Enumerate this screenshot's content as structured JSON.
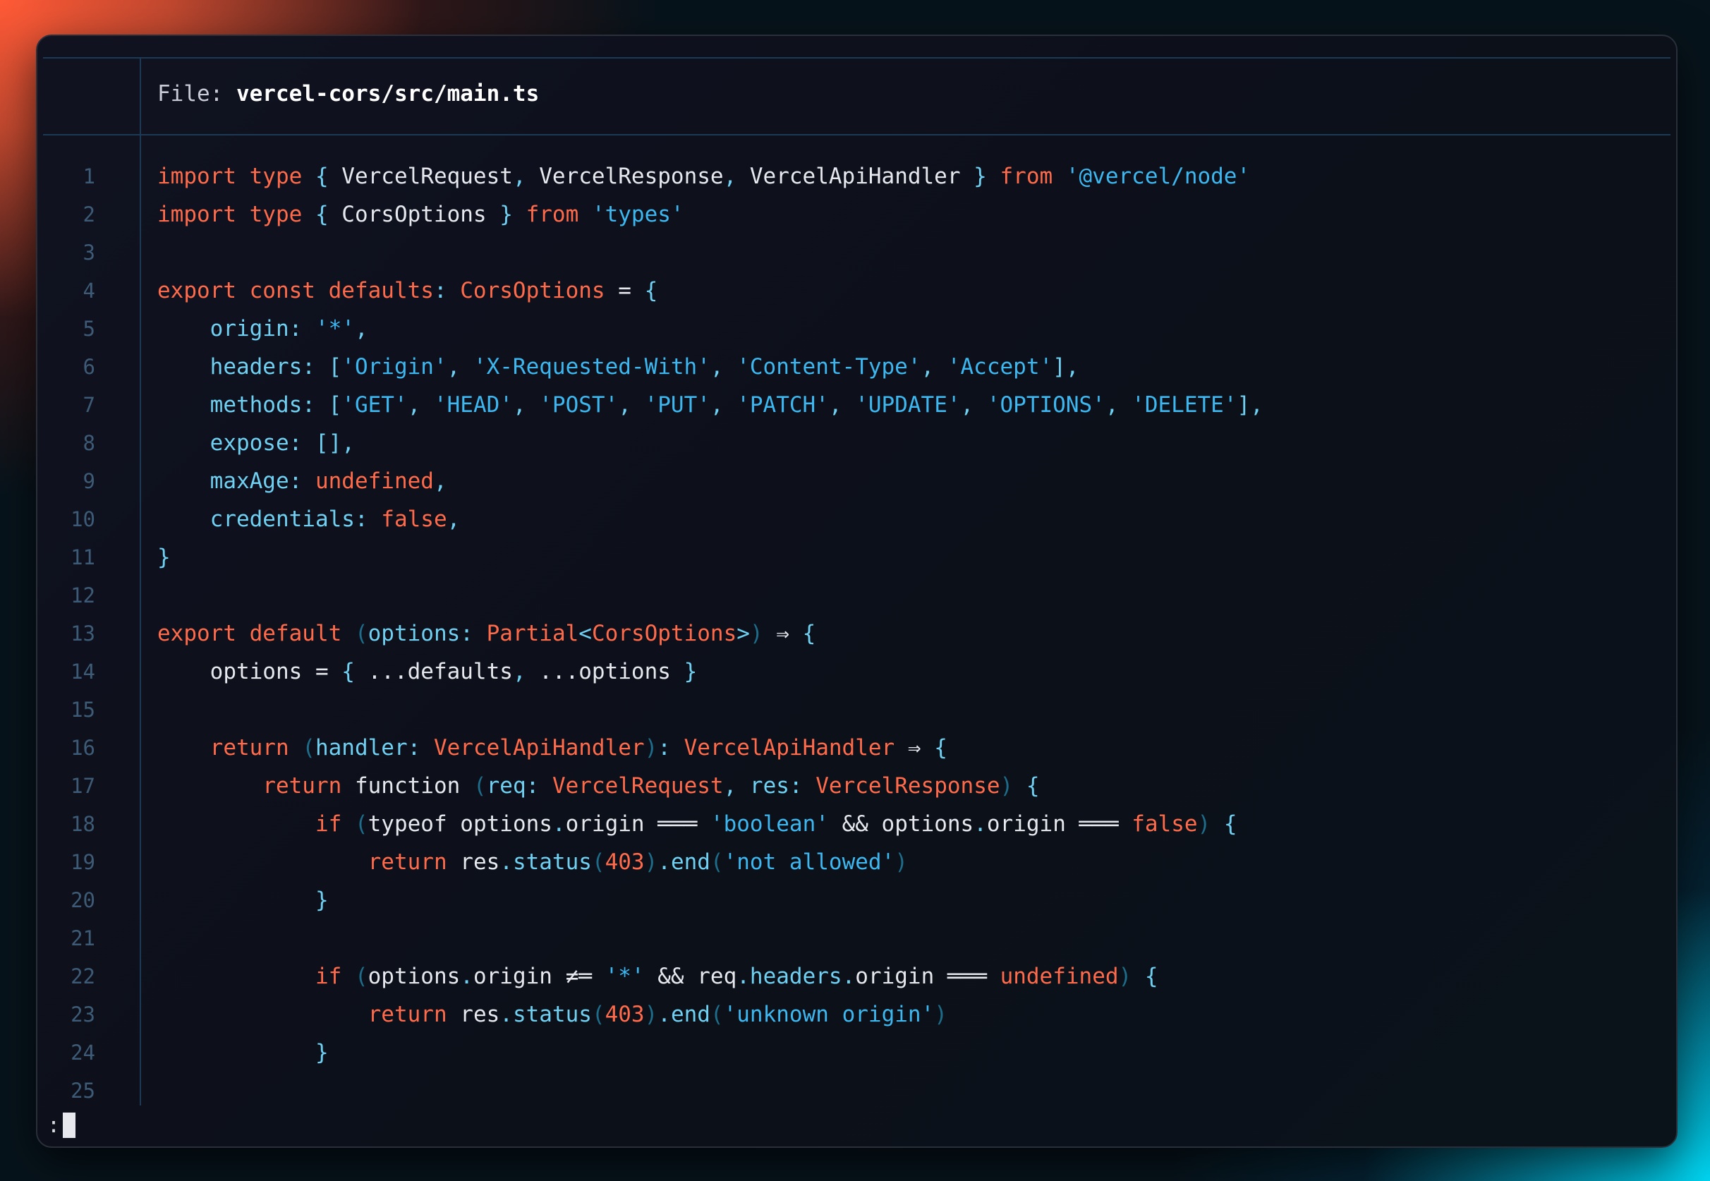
{
  "header": {
    "prefix": "File: ",
    "filename": "vercel-cors/src/main.ts"
  },
  "line_numbers": [
    "1",
    "2",
    "3",
    "4",
    "5",
    "6",
    "7",
    "8",
    "9",
    "10",
    "11",
    "12",
    "13",
    "14",
    "15",
    "16",
    "17",
    "18",
    "19",
    "20",
    "21",
    "22",
    "23",
    "24",
    "25"
  ],
  "code_lines": [
    [
      [
        "k",
        "import type "
      ],
      [
        "p",
        "{ "
      ],
      [
        "pl",
        "VercelRequest"
      ],
      [
        "p",
        ", "
      ],
      [
        "pl",
        "VercelResponse"
      ],
      [
        "p",
        ", "
      ],
      [
        "pl",
        "VercelApiHandler"
      ],
      [
        "p",
        " } "
      ],
      [
        "k",
        "from "
      ],
      [
        "s",
        "'@vercel/node'"
      ]
    ],
    [
      [
        "k",
        "import type "
      ],
      [
        "p",
        "{ "
      ],
      [
        "pl",
        "CorsOptions"
      ],
      [
        "p",
        " } "
      ],
      [
        "k",
        "from "
      ],
      [
        "s",
        "'types'"
      ]
    ],
    [],
    [
      [
        "k",
        "export const defaults"
      ],
      [
        "p",
        ": "
      ],
      [
        "t",
        "CorsOptions"
      ],
      [
        "pl",
        " = "
      ],
      [
        "p",
        "{"
      ]
    ],
    [
      [
        "pl",
        "    "
      ],
      [
        "p",
        "origin: "
      ],
      [
        "s",
        "'*'"
      ],
      [
        "p",
        ","
      ]
    ],
    [
      [
        "pl",
        "    "
      ],
      [
        "p",
        "headers: ["
      ],
      [
        "s",
        "'Origin'"
      ],
      [
        "p",
        ", "
      ],
      [
        "s",
        "'X-Requested-With'"
      ],
      [
        "p",
        ", "
      ],
      [
        "s",
        "'Content-Type'"
      ],
      [
        "p",
        ", "
      ],
      [
        "s",
        "'Accept'"
      ],
      [
        "p",
        "],"
      ]
    ],
    [
      [
        "pl",
        "    "
      ],
      [
        "p",
        "methods: ["
      ],
      [
        "s",
        "'GET'"
      ],
      [
        "p",
        ", "
      ],
      [
        "s",
        "'HEAD'"
      ],
      [
        "p",
        ", "
      ],
      [
        "s",
        "'POST'"
      ],
      [
        "p",
        ", "
      ],
      [
        "s",
        "'PUT'"
      ],
      [
        "p",
        ", "
      ],
      [
        "s",
        "'PATCH'"
      ],
      [
        "p",
        ", "
      ],
      [
        "s",
        "'UPDATE'"
      ],
      [
        "p",
        ", "
      ],
      [
        "s",
        "'OPTIONS'"
      ],
      [
        "p",
        ", "
      ],
      [
        "s",
        "'DELETE'"
      ],
      [
        "p",
        "],"
      ]
    ],
    [
      [
        "pl",
        "    "
      ],
      [
        "p",
        "expose: [],"
      ]
    ],
    [
      [
        "pl",
        "    "
      ],
      [
        "p",
        "maxAge: "
      ],
      [
        "k",
        "undefined"
      ],
      [
        "p",
        ","
      ]
    ],
    [
      [
        "pl",
        "    "
      ],
      [
        "p",
        "credentials: "
      ],
      [
        "k",
        "false"
      ],
      [
        "p",
        ","
      ]
    ],
    [
      [
        "p",
        "}"
      ]
    ],
    [],
    [
      [
        "k",
        "export default "
      ],
      [
        "pr",
        "("
      ],
      [
        "p",
        "options: "
      ],
      [
        "t",
        "Partial"
      ],
      [
        "p",
        "<"
      ],
      [
        "t",
        "CorsOptions"
      ],
      [
        "p",
        ">"
      ],
      [
        "pr",
        ")"
      ],
      [
        "pl",
        " ⇒ "
      ],
      [
        "p",
        "{"
      ]
    ],
    [
      [
        "pl",
        "    options = "
      ],
      [
        "p",
        "{ "
      ],
      [
        "pl",
        "...defaults"
      ],
      [
        "p",
        ", "
      ],
      [
        "pl",
        "...options "
      ],
      [
        "p",
        "}"
      ]
    ],
    [],
    [
      [
        "pl",
        "    "
      ],
      [
        "k",
        "return "
      ],
      [
        "pr",
        "("
      ],
      [
        "p",
        "handler: "
      ],
      [
        "t",
        "VercelApiHandler"
      ],
      [
        "pr",
        ")"
      ],
      [
        "p",
        ": "
      ],
      [
        "t",
        "VercelApiHandler"
      ],
      [
        "pl",
        " ⇒ "
      ],
      [
        "p",
        "{"
      ]
    ],
    [
      [
        "pl",
        "        "
      ],
      [
        "k",
        "return "
      ],
      [
        "pl",
        "function "
      ],
      [
        "pr",
        "("
      ],
      [
        "p",
        "req: "
      ],
      [
        "t",
        "VercelRequest"
      ],
      [
        "p",
        ", "
      ],
      [
        "p",
        "res: "
      ],
      [
        "t",
        "VercelResponse"
      ],
      [
        "pr",
        ")"
      ],
      [
        "p",
        " {"
      ]
    ],
    [
      [
        "pl",
        "            "
      ],
      [
        "k",
        "if "
      ],
      [
        "pr",
        "("
      ],
      [
        "pl",
        "typeof options"
      ],
      [
        "p",
        "."
      ],
      [
        "pl",
        "origin ═══ "
      ],
      [
        "s",
        "'boolean'"
      ],
      [
        "pl",
        " && options"
      ],
      [
        "p",
        "."
      ],
      [
        "pl",
        "origin ═══ "
      ],
      [
        "k",
        "false"
      ],
      [
        "pr",
        ")"
      ],
      [
        "p",
        " {"
      ]
    ],
    [
      [
        "pl",
        "                "
      ],
      [
        "k",
        "return "
      ],
      [
        "pl",
        "res"
      ],
      [
        "p",
        ".status"
      ],
      [
        "pr",
        "("
      ],
      [
        "k",
        "403"
      ],
      [
        "pr",
        ")"
      ],
      [
        "p",
        ".end"
      ],
      [
        "pr",
        "("
      ],
      [
        "s",
        "'not allowed'"
      ],
      [
        "pr",
        ")"
      ]
    ],
    [
      [
        "pl",
        "            "
      ],
      [
        "p",
        "}"
      ]
    ],
    [],
    [
      [
        "pl",
        "            "
      ],
      [
        "k",
        "if "
      ],
      [
        "pr",
        "("
      ],
      [
        "pl",
        "options"
      ],
      [
        "p",
        "."
      ],
      [
        "pl",
        "origin ≠═ "
      ],
      [
        "s",
        "'*'"
      ],
      [
        "pl",
        " && req"
      ],
      [
        "p",
        ".headers."
      ],
      [
        "pl",
        "origin ═══ "
      ],
      [
        "k",
        "undefined"
      ],
      [
        "pr",
        ")"
      ],
      [
        "p",
        " {"
      ]
    ],
    [
      [
        "pl",
        "                "
      ],
      [
        "k",
        "return "
      ],
      [
        "pl",
        "res"
      ],
      [
        "p",
        ".status"
      ],
      [
        "pr",
        "("
      ],
      [
        "k",
        "403"
      ],
      [
        "pr",
        ")"
      ],
      [
        "p",
        ".end"
      ],
      [
        "pr",
        "("
      ],
      [
        "s",
        "'unknown origin'"
      ],
      [
        "pr",
        ")"
      ]
    ],
    [
      [
        "pl",
        "            "
      ],
      [
        "p",
        "}"
      ]
    ],
    []
  ],
  "prompt": {
    "text": ":"
  }
}
